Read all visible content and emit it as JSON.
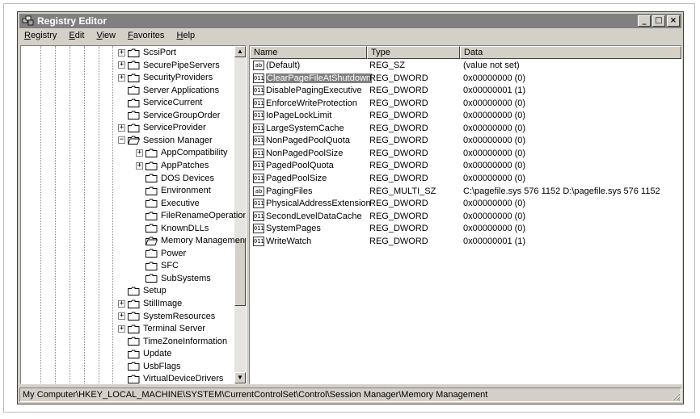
{
  "window": {
    "title": "Registry Editor",
    "min_btn": "_",
    "max_btn": "□",
    "close_btn": "×"
  },
  "menu": [
    {
      "accel": "R",
      "rest": "egistry"
    },
    {
      "accel": "E",
      "rest": "dit"
    },
    {
      "accel": "V",
      "rest": "iew"
    },
    {
      "accel": "F",
      "rest": "avorites"
    },
    {
      "accel": "H",
      "rest": "elp"
    }
  ],
  "tree": {
    "items": [
      {
        "label": "ScsiPort",
        "level": 0,
        "expander": "+"
      },
      {
        "label": "SecurePipeServers",
        "level": 0,
        "expander": "+"
      },
      {
        "label": "SecurityProviders",
        "level": 0,
        "expander": "+"
      },
      {
        "label": "Server Applications",
        "level": 0,
        "expander": ""
      },
      {
        "label": "ServiceCurrent",
        "level": 0,
        "expander": ""
      },
      {
        "label": "ServiceGroupOrder",
        "level": 0,
        "expander": ""
      },
      {
        "label": "ServiceProvider",
        "level": 0,
        "expander": "+"
      },
      {
        "label": "Session Manager",
        "level": 0,
        "expander": "−",
        "open": true
      },
      {
        "label": "AppCompatibility",
        "level": 1,
        "expander": "+"
      },
      {
        "label": "AppPatches",
        "level": 1,
        "expander": "+"
      },
      {
        "label": "DOS Devices",
        "level": 1,
        "expander": ""
      },
      {
        "label": "Environment",
        "level": 1,
        "expander": ""
      },
      {
        "label": "Executive",
        "level": 1,
        "expander": ""
      },
      {
        "label": "FileRenameOperations",
        "level": 1,
        "expander": ""
      },
      {
        "label": "KnownDLLs",
        "level": 1,
        "expander": ""
      },
      {
        "label": "Memory Management",
        "level": 1,
        "expander": "",
        "open": true
      },
      {
        "label": "Power",
        "level": 1,
        "expander": ""
      },
      {
        "label": "SFC",
        "level": 1,
        "expander": ""
      },
      {
        "label": "SubSystems",
        "level": 1,
        "expander": ""
      },
      {
        "label": "Setup",
        "level": 0,
        "expander": ""
      },
      {
        "label": "StillImage",
        "level": 0,
        "expander": "+"
      },
      {
        "label": "SystemResources",
        "level": 0,
        "expander": "+"
      },
      {
        "label": "Terminal Server",
        "level": 0,
        "expander": "+"
      },
      {
        "label": "TimeZoneInformation",
        "level": 0,
        "expander": ""
      },
      {
        "label": "Update",
        "level": 0,
        "expander": ""
      },
      {
        "label": "UsbFlags",
        "level": 0,
        "expander": ""
      },
      {
        "label": "VirtualDeviceDrivers",
        "level": 0,
        "expander": ""
      }
    ],
    "scroll_up": "▲",
    "scroll_down": "▼"
  },
  "list": {
    "columns": [
      "Name",
      "Type",
      "Data"
    ],
    "rows": [
      {
        "name": "(Default)",
        "type": "REG_SZ",
        "data": "(value not set)",
        "icon": "ab",
        "selected": false
      },
      {
        "name": "ClearPageFileAtShutdown",
        "type": "REG_DWORD",
        "data": "0x00000000 (0)",
        "icon": "011",
        "selected": true
      },
      {
        "name": "DisablePagingExecutive",
        "type": "REG_DWORD",
        "data": "0x00000001 (1)",
        "icon": "011",
        "selected": false
      },
      {
        "name": "EnforceWriteProtection",
        "type": "REG_DWORD",
        "data": "0x00000000 (0)",
        "icon": "011",
        "selected": false
      },
      {
        "name": "IoPageLockLimit",
        "type": "REG_DWORD",
        "data": "0x00000000 (0)",
        "icon": "011",
        "selected": false
      },
      {
        "name": "LargeSystemCache",
        "type": "REG_DWORD",
        "data": "0x00000000 (0)",
        "icon": "011",
        "selected": false
      },
      {
        "name": "NonPagedPoolQuota",
        "type": "REG_DWORD",
        "data": "0x00000000 (0)",
        "icon": "011",
        "selected": false
      },
      {
        "name": "NonPagedPoolSize",
        "type": "REG_DWORD",
        "data": "0x00000000 (0)",
        "icon": "011",
        "selected": false
      },
      {
        "name": "PagedPoolQuota",
        "type": "REG_DWORD",
        "data": "0x00000000 (0)",
        "icon": "011",
        "selected": false
      },
      {
        "name": "PagedPoolSize",
        "type": "REG_DWORD",
        "data": "0x00000000 (0)",
        "icon": "011",
        "selected": false
      },
      {
        "name": "PagingFiles",
        "type": "REG_MULTI_SZ",
        "data": "C:\\pagefile.sys 576 1152 D:\\pagefile.sys 576 1152",
        "icon": "ab",
        "selected": false
      },
      {
        "name": "PhysicalAddressExtension",
        "type": "REG_DWORD",
        "data": "0x00000000 (0)",
        "icon": "011",
        "selected": false
      },
      {
        "name": "SecondLevelDataCache",
        "type": "REG_DWORD",
        "data": "0x00000000 (0)",
        "icon": "011",
        "selected": false
      },
      {
        "name": "SystemPages",
        "type": "REG_DWORD",
        "data": "0x00000000 (0)",
        "icon": "011",
        "selected": false
      },
      {
        "name": "WriteWatch",
        "type": "REG_DWORD",
        "data": "0x00000001 (1)",
        "icon": "011",
        "selected": false
      }
    ]
  },
  "status": "My Computer\\HKEY_LOCAL_MACHINE\\SYSTEM\\CurrentControlSet\\Control\\Session Manager\\Memory Management",
  "colors": {
    "face": "#d4d0c8",
    "title_inactive": "#808080",
    "selection": "#808080"
  }
}
